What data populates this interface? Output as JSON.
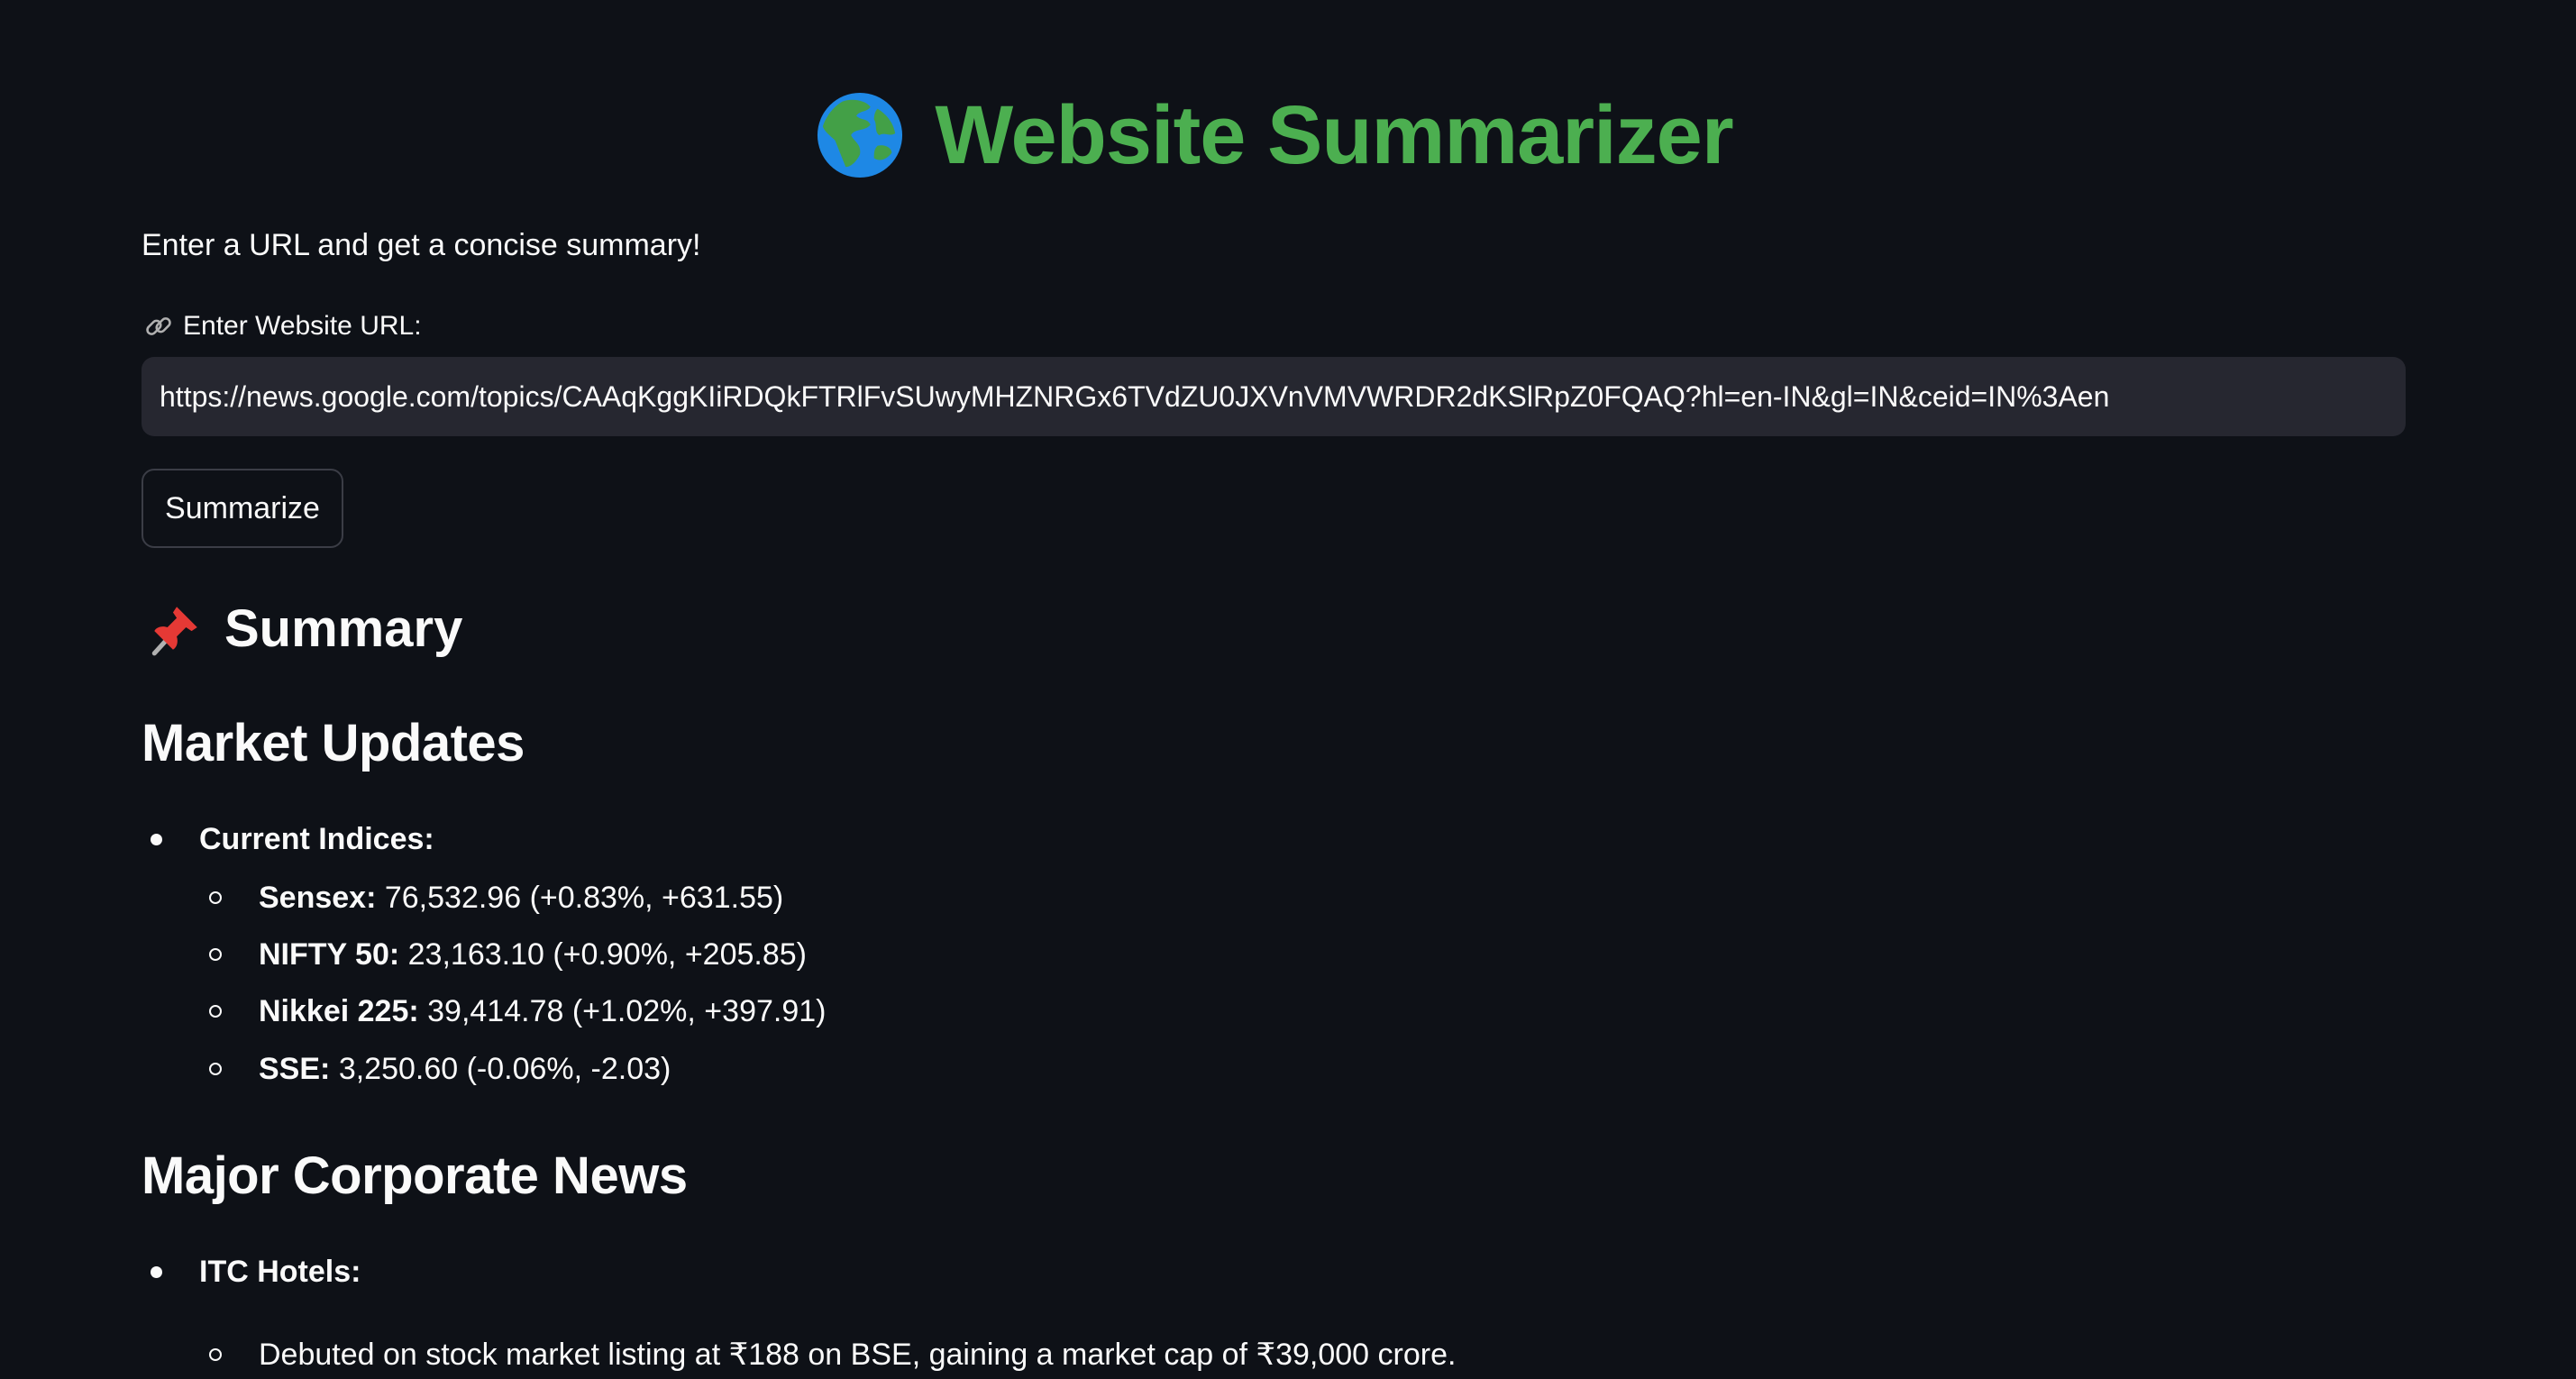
{
  "header": {
    "title": "Website Summarizer",
    "icon": "globe-icon",
    "title_color": "#4caf50"
  },
  "intro": {
    "text": "Enter a URL and get a concise summary!"
  },
  "url_field": {
    "label": "Enter Website URL:",
    "label_icon": "link-icon",
    "value": "https://news.google.com/topics/CAAqKggKIiRDQkFTRlFvSUwyMHZNRGx6TVdZU0JXVnVMVWRDR2dKSlRpZ0FQAQ?hl=en-IN&gl=IN&ceid=IN%3Aen"
  },
  "actions": {
    "summarize_label": "Summarize"
  },
  "summary": {
    "heading": "Summary",
    "heading_icon": "pushpin-icon",
    "sections": {
      "market": {
        "title": "Market Updates",
        "group_label": "Current Indices:",
        "items": [
          {
            "name": "Sensex:",
            "value": "76,532.96 (+0.83%, +631.55)"
          },
          {
            "name": "NIFTY 50:",
            "value": "23,163.10 (+0.90%, +205.85)"
          },
          {
            "name": "Nikkei 225:",
            "value": "39,414.78 (+1.02%, +397.91)"
          },
          {
            "name": "SSE:",
            "value": "3,250.60 (-0.06%, -2.03)"
          }
        ]
      },
      "corporate": {
        "title": "Major Corporate News",
        "group_label": "ITC Hotels:",
        "items": [
          {
            "text": "Debuted on stock market listing at ₹188 on BSE, gaining a market cap of ₹39,000 crore."
          }
        ]
      }
    }
  }
}
